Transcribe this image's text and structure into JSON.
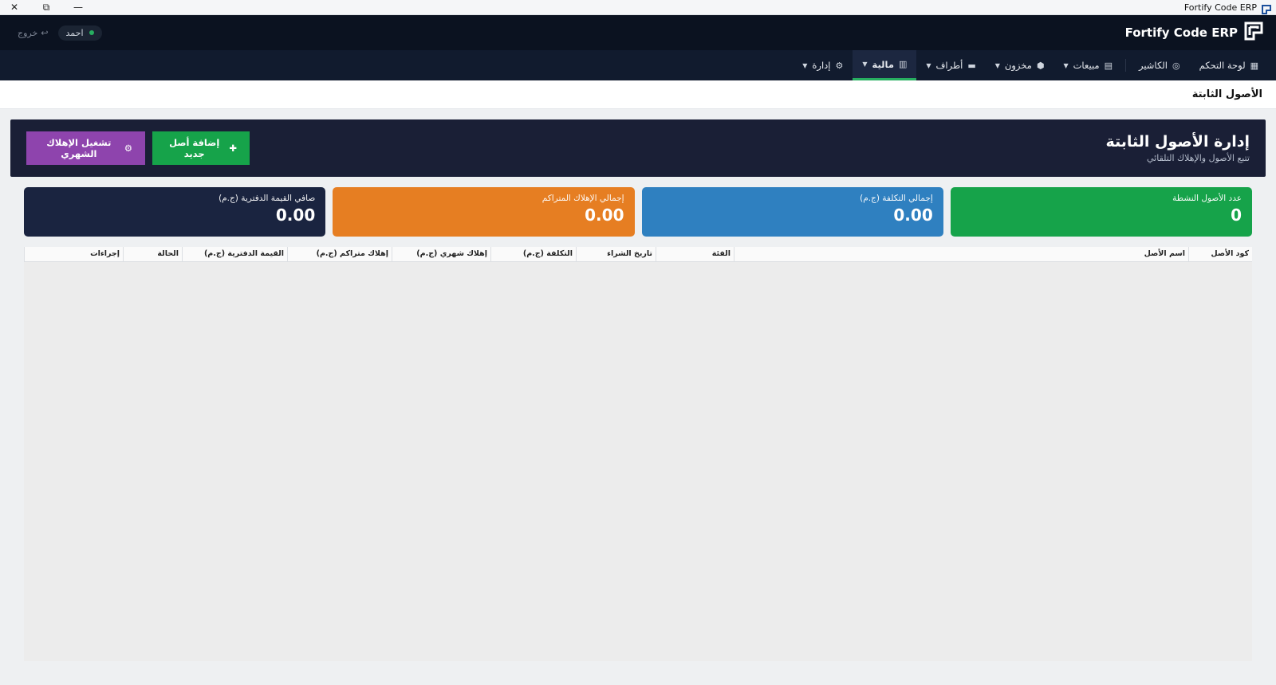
{
  "window": {
    "title": "Fortify Code ERP",
    "controls": {
      "close": "✕",
      "restore": "⧉",
      "minimize": "—"
    }
  },
  "header": {
    "brand": "Fortify Code ERP",
    "user": "احمد",
    "logout": "خروج"
  },
  "nav": {
    "items": [
      {
        "label": "لوحة التحكم",
        "icon": "dashboard-icon",
        "has_menu": false,
        "active": false
      },
      {
        "label": "الكاشير",
        "icon": "cashier-icon",
        "has_menu": false,
        "active": false
      },
      {
        "label": "مبيعات",
        "icon": "receipt-icon",
        "has_menu": true,
        "active": false
      },
      {
        "label": "مخزون",
        "icon": "box-icon",
        "has_menu": true,
        "active": false
      },
      {
        "label": "أطراف",
        "icon": "users-icon",
        "has_menu": true,
        "active": false
      },
      {
        "label": "مالية",
        "icon": "ledger-icon",
        "has_menu": true,
        "active": true
      },
      {
        "label": "إدارة",
        "icon": "gear-icon",
        "has_menu": true,
        "active": false
      }
    ]
  },
  "page": {
    "strip_title": "الأصول الثابتة",
    "title": "إدارة الأصول الثابتة",
    "subtitle": "تتبع الأصول والإهلاك التلقائي",
    "buttons": {
      "add_asset": "إضافة أصل جديد",
      "run_depreciation": "تشغيل الإهلاك الشهري"
    }
  },
  "stats": {
    "active_count": {
      "label": "عدد الأصول النشطة",
      "value": "0"
    },
    "total_cost": {
      "label": "إجمالي التكلفة (ج.م)",
      "value": "0.00"
    },
    "accumulated_dep": {
      "label": "إجمالي الإهلاك المتراكم",
      "value": "0.00"
    },
    "net_book": {
      "label": "صافي القيمة الدفترية (ج.م)",
      "value": "0.00"
    }
  },
  "table": {
    "columns": [
      "كود الأصل",
      "اسم الأصل",
      "الفئة",
      "تاريخ الشراء",
      "التكلفة (ج.م)",
      "إهلاك شهري (ج.م)",
      "إهلاك متراكم (ج.م)",
      "القيمة الدفترية (ج.م)",
      "الحالة",
      "إجراءات"
    ],
    "rows": []
  },
  "colors": {
    "header_bg": "#0b1220",
    "nav_bg": "#111b2e",
    "hero_bg": "#1a1f36",
    "green": "#16a34a",
    "blue": "#2f80c0",
    "orange": "#e67e22",
    "navy": "#1a2440",
    "purple": "#8e44ad"
  }
}
